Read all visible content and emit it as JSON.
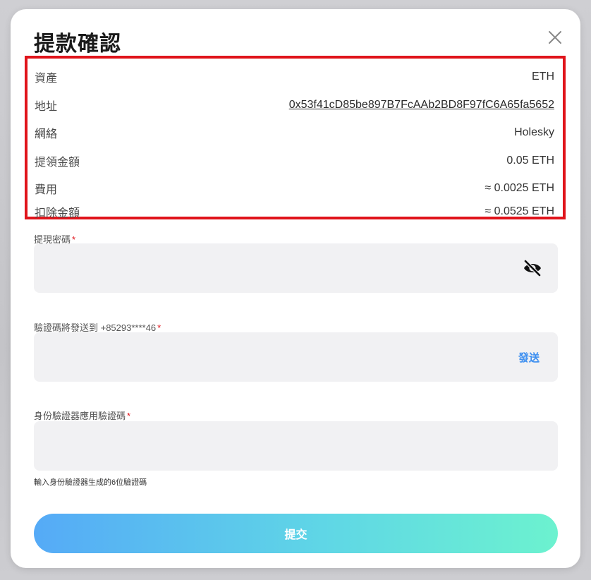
{
  "modal": {
    "title": "提款確認",
    "close_icon": "close-icon"
  },
  "details": [
    {
      "label": "資產",
      "value": "ETH"
    },
    {
      "label": "地址",
      "value": "0x53f41cD85be897B7FcAAb2BD8F97fC6A65fa5652"
    },
    {
      "label": "網絡",
      "value": "Holesky"
    },
    {
      "label": "提領金額",
      "value": "0.05 ETH"
    },
    {
      "label": "費用",
      "value": "≈ 0.0025 ETH"
    },
    {
      "label": "扣除金額",
      "value": "≈ 0.0525 ETH"
    }
  ],
  "fields": {
    "password": {
      "label": "提現密碼",
      "required": "*",
      "value": "",
      "icon": "eye-slash-icon"
    },
    "sms": {
      "label": "驗證碼將發送到 +85293****46",
      "required": "*",
      "value": "",
      "send_label": "發送"
    },
    "authenticator": {
      "label": "身份驗證器應用驗證碼",
      "required": "*",
      "value": "",
      "hint": "輸入身份驗證器生成的6位驗證碼"
    }
  },
  "submit_label": "提交",
  "colors": {
    "highlight_border": "#e0141b",
    "accent_link": "#3d8ff0",
    "button_gradient_start": "#55aaf7",
    "button_gradient_end": "#6cf2cf",
    "input_bg": "#f1f1f3"
  }
}
